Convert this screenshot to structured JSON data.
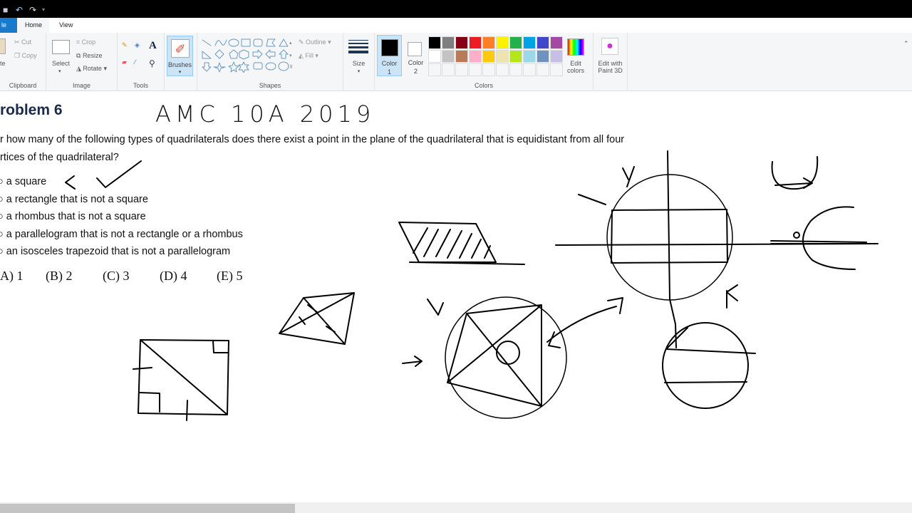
{
  "titlebar": {
    "icons": [
      "save-icon",
      "undo-icon",
      "redo-icon",
      "customize-icon"
    ]
  },
  "tabs": [
    {
      "label": "le"
    },
    {
      "label": "Home"
    },
    {
      "label": "View"
    }
  ],
  "ribbon": {
    "clipboard": {
      "paste": "te",
      "cut": "Cut",
      "copy": "Copy",
      "label": "Clipboard"
    },
    "image": {
      "select": "Select",
      "crop": "Crop",
      "resize": "Resize",
      "rotate": "Rotate",
      "label": "Image"
    },
    "tools": {
      "label": "Tools"
    },
    "brushes": {
      "label": "Brushes"
    },
    "shapes": {
      "outline": "Outline",
      "fill": "Fill",
      "label": "Shapes"
    },
    "size": {
      "label": "Size"
    },
    "color1": {
      "label": "Color",
      "num": "1",
      "color": "#000000"
    },
    "color2": {
      "label": "Color",
      "num": "2",
      "color": "#ffffff"
    },
    "palette": [
      "#000000",
      "#7f7f7f",
      "#880015",
      "#ed1c24",
      "#ff7f27",
      "#fff200",
      "#22b14c",
      "#00a2e8",
      "#3f48cc",
      "#a349a4",
      "#ffffff",
      "#c3c3c3",
      "#b97a57",
      "#ffaec9",
      "#ffc90e",
      "#efe4b0",
      "#b5e61d",
      "#99d9ea",
      "#7092be",
      "#c8bfe7"
    ],
    "edit_colors": {
      "line1": "Edit",
      "line2": "colors"
    },
    "colors_label": "Colors",
    "paint3d": {
      "line1": "Edit with",
      "line2": "Paint 3D"
    }
  },
  "canvas": {
    "heading": "roblem 6",
    "handwritten_title": "AMC 10A 2019",
    "question_line1": "r how many of the following types of quadrilaterals does there exist a point in the plane of the quadrilateral that is equidistant from all four",
    "question_line2": "rtices of the quadrilateral?",
    "items": [
      "a square",
      "a rectangle that is not a square",
      "a rhombus that is not a square",
      "a parallelogram that is not a rectangle or a rhombus",
      "an isosceles trapezoid that is not a parallelogram"
    ],
    "choices": [
      "A) 1",
      "(B) 2",
      "(C) 3",
      "(D) 4",
      "(E) 5"
    ]
  }
}
